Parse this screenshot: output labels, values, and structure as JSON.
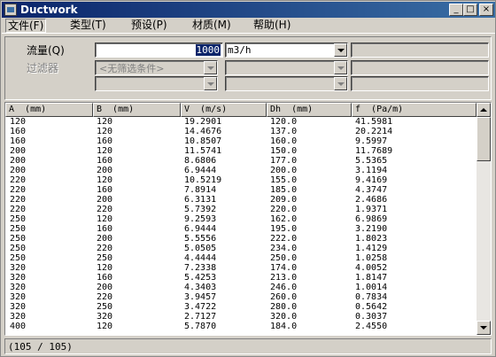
{
  "window": {
    "title": "Ductwork",
    "controls": [
      "_",
      "□",
      "×"
    ]
  },
  "menu": [
    {
      "label": "文件(F)",
      "active": true
    },
    {
      "label": "类型(T)",
      "active": false
    },
    {
      "label": "预设(P)",
      "active": false
    },
    {
      "label": "材质(M)",
      "active": false
    },
    {
      "label": "帮助(H)",
      "active": false
    }
  ],
  "filter": {
    "flow_label": "流量(Q)",
    "flow_value": "1000",
    "flow_unit": "m3/h",
    "filter_label": "过滤器",
    "filter_placeholder": "<无筛选条件>"
  },
  "table": {
    "columns": [
      "A  (mm)",
      "B  (mm)",
      "V  (m/s)",
      "Dh  (mm)",
      "f  (Pa/m)"
    ],
    "rows": [
      [
        "120",
        "120",
        "19.2901",
        "120.0",
        "41.5981"
      ],
      [
        "160",
        "120",
        "14.4676",
        "137.0",
        "20.2214"
      ],
      [
        "160",
        "160",
        "10.8507",
        "160.0",
        "9.5997"
      ],
      [
        "200",
        "120",
        "11.5741",
        "150.0",
        "11.7689"
      ],
      [
        "200",
        "160",
        "8.6806",
        "177.0",
        "5.5365"
      ],
      [
        "200",
        "200",
        "6.9444",
        "200.0",
        "3.1194"
      ],
      [
        "220",
        "120",
        "10.5219",
        "155.0",
        "9.4169"
      ],
      [
        "220",
        "160",
        "7.8914",
        "185.0",
        "4.3747"
      ],
      [
        "220",
        "200",
        "6.3131",
        "209.0",
        "2.4686"
      ],
      [
        "220",
        "220",
        "5.7392",
        "220.0",
        "1.9371"
      ],
      [
        "250",
        "120",
        "9.2593",
        "162.0",
        "6.9869"
      ],
      [
        "250",
        "160",
        "6.9444",
        "195.0",
        "3.2190"
      ],
      [
        "250",
        "200",
        "5.5556",
        "222.0",
        "1.8023"
      ],
      [
        "250",
        "220",
        "5.0505",
        "234.0",
        "1.4129"
      ],
      [
        "250",
        "250",
        "4.4444",
        "250.0",
        "1.0258"
      ],
      [
        "320",
        "120",
        "7.2338",
        "174.0",
        "4.0052"
      ],
      [
        "320",
        "160",
        "5.4253",
        "213.0",
        "1.8147"
      ],
      [
        "320",
        "200",
        "4.3403",
        "246.0",
        "1.0014"
      ],
      [
        "320",
        "220",
        "3.9457",
        "260.0",
        "0.7834"
      ],
      [
        "320",
        "250",
        "3.4722",
        "280.0",
        "0.5642"
      ],
      [
        "320",
        "320",
        "2.7127",
        "320.0",
        "0.3037"
      ],
      [
        "400",
        "120",
        "5.7870",
        "184.0",
        "2.4550"
      ]
    ]
  },
  "status": {
    "text": "(105 / 105)"
  }
}
